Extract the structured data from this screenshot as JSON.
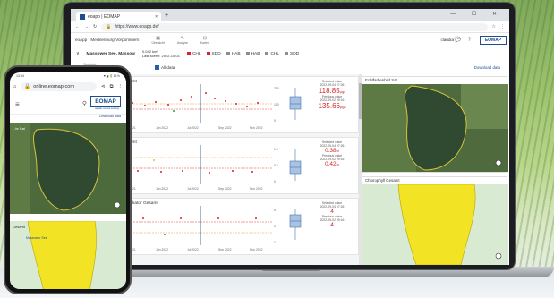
{
  "browser": {
    "tab_title": "eoapp | EOMAP",
    "tab_close": "×",
    "new_tab": "+",
    "url": "https://www.eoapp.de/",
    "window_controls": "—  ☐  ✕"
  },
  "app": {
    "region": "eoApp · Mecklenburg-Vorpommern",
    "nav": [
      {
        "icon": "▣",
        "label": "Übersicht"
      },
      {
        "icon": "✎",
        "label": "Analyse"
      },
      {
        "icon": "⊡",
        "label": "Karten"
      }
    ],
    "user": "claudia",
    "brand": "EOMAP"
  },
  "lake": {
    "name": "Massower See, Massow",
    "area": "0.042 km²",
    "last_scene": "Last scene: 2022-10-01",
    "legend": [
      {
        "label": "CHL",
        "color": "#d8232a"
      },
      {
        "label": "SDD",
        "color": "#d8232a"
      },
      {
        "label": "HAB",
        "color": "#8d8d8d"
      },
      {
        "label": "HAB",
        "color": "#8d8d8d"
      },
      {
        "label": "CHL",
        "color": "#8d8d8d"
      },
      {
        "label": "SDD",
        "color": "#8d8d8d"
      }
    ]
  },
  "filters": {
    "start_label": "Startdate",
    "start": "2021-03-07",
    "checkbox": "All data",
    "download": "Download data"
  },
  "charts": [
    {
      "title": "Gesamt",
      "selected_label": "Selected value",
      "selected_date": "2022-09-04 07:26",
      "value1": "118.85",
      "unit": "µg/l",
      "prev_label": "Previous value",
      "prev_date": "2022-09-02 09:16",
      "value2": "135.66",
      "ylabels": [
        "200",
        "100",
        "0"
      ]
    },
    {
      "title": "Gesamt",
      "selected_label": "Selected value",
      "selected_date": "2022-09-04 07:26",
      "value1": "0.38",
      "unit": "m",
      "prev_label": "Previous value",
      "prev_date": "2022-09-02 09:16",
      "value2": "0.42",
      "ylabels": [
        "1.0",
        "0.5",
        "0"
      ]
    },
    {
      "title": "n-Indikator Gesamt",
      "selected_label": "Selected value",
      "selected_date": "2022-09-04 07:26",
      "value1": "4",
      "unit": "",
      "prev_label": "Previous value",
      "prev_date": "2022-09-02 09:16",
      "value2": "4",
      "ylabels": [
        "5",
        "3",
        "1"
      ]
    }
  ],
  "x_ticks": [
    "Jan 2021",
    "Jul 2021",
    "Jan 2022",
    "Jul 2022",
    "Sep 2022",
    "Nov 2022"
  ],
  "maps": [
    {
      "label": "Echtfarbenbild Sat"
    },
    {
      "label": "Chlorophyll Gesamt"
    }
  ],
  "phone": {
    "time": "13:54",
    "status_right": "▼◢ 🔋81%",
    "url": "online.eomap.com",
    "brand": "EOMAP",
    "brand_tag": "aquatic remote sensing",
    "download": "Download data",
    "map_label_top": "...te Sat",
    "map_label_bottom": "Gesamt",
    "place": "Massower See"
  },
  "colors": {
    "accent": "#1e4c8f",
    "alert": "#d8232a",
    "hab_yellow": "#f2e325"
  }
}
